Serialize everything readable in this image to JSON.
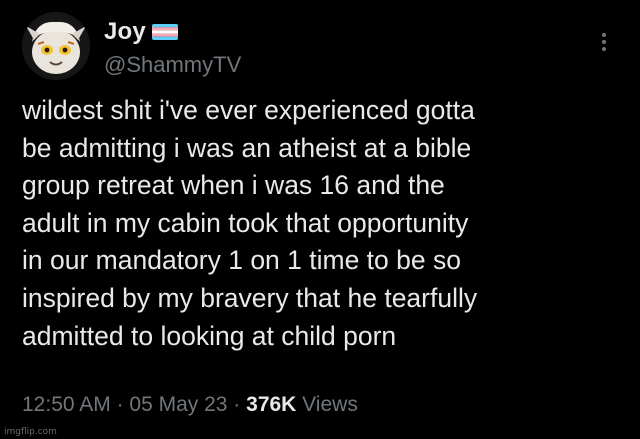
{
  "author": {
    "display_name": "Joy",
    "handle": "@ShammyTV",
    "flag_icon": "transgender-flag-icon"
  },
  "tweet": {
    "lines": [
      "wildest shit i've ever experienced gotta",
      "be admitting i was an atheist at a bible",
      "group retreat when i was 16 and the",
      "adult in my cabin took that opportunity",
      "in our mandatory 1 on 1 time to be so",
      "inspired by my bravery that he tearfully",
      "admitted to looking at child porn"
    ]
  },
  "meta": {
    "time": "12:50 AM",
    "separator": " · ",
    "date": "05 May 23",
    "views_count": "376K",
    "views_label": " Views"
  },
  "watermark": "imgflip.com",
  "colors": {
    "background": "#000000",
    "text_primary": "#e7e9ea",
    "text_secondary": "#71767b",
    "flag_blue": "#5bcefa",
    "flag_pink": "#f5a9b8",
    "flag_white": "#ffffff"
  }
}
